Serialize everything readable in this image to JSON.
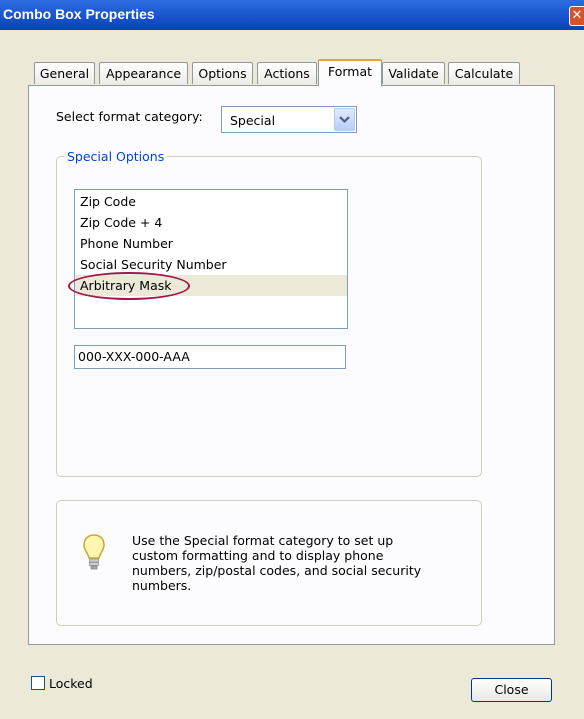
{
  "window": {
    "title": "Combo Box Properties",
    "close_glyph": "✕"
  },
  "tabs": [
    {
      "label": "General",
      "active": false
    },
    {
      "label": "Appearance",
      "active": false
    },
    {
      "label": "Options",
      "active": false
    },
    {
      "label": "Actions",
      "active": false
    },
    {
      "label": "Format",
      "active": true
    },
    {
      "label": "Validate",
      "active": false
    },
    {
      "label": "Calculate",
      "active": false
    }
  ],
  "format": {
    "category_label": "Select format category:",
    "category_value": "Special",
    "group_title": "Special Options",
    "options": [
      {
        "label": "Zip Code",
        "selected": false
      },
      {
        "label": "Zip Code + 4",
        "selected": false
      },
      {
        "label": "Phone Number",
        "selected": false
      },
      {
        "label": "Social Security Number",
        "selected": false
      },
      {
        "label": "Arbitrary Mask",
        "selected": true
      }
    ],
    "mask_value": "000-XXX-000-AAA",
    "help_text": "Use the Special format category to set up custom formatting and to display phone numbers, zip/postal codes, and social security numbers.",
    "help_icon": "lightbulb-icon"
  },
  "footer": {
    "locked_label": "Locked",
    "locked_checked": false,
    "close_label": "Close"
  },
  "colors": {
    "titlebar": "#1c58cf",
    "active_tab_accent": "#e6a530",
    "group_title": "#0046d5",
    "annotation": "#a3174d"
  }
}
